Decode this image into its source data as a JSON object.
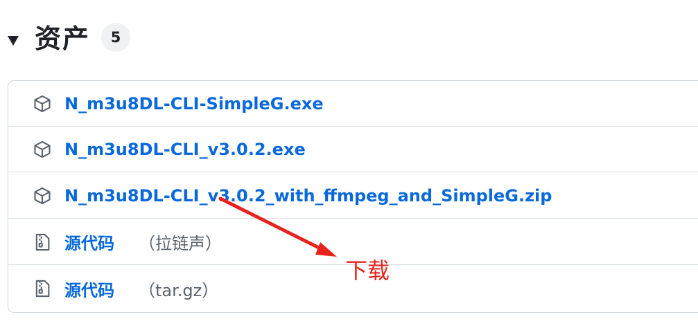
{
  "assets_section": {
    "title": "资产",
    "count": "5",
    "expanded": true,
    "toggle_icon": "triangle-down-icon"
  },
  "assets": [
    {
      "name": "N_m3u8DL-CLI-SimpleG.exe",
      "suffix": "",
      "icon": "package-icon"
    },
    {
      "name": "N_m3u8DL-CLI_v3.0.2.exe",
      "suffix": "",
      "icon": "package-icon"
    },
    {
      "name": "N_m3u8DL-CLI_v3.0.2_with_ffmpeg_and_SimpleG.zip",
      "suffix": "",
      "icon": "package-icon"
    },
    {
      "name": "源代码",
      "suffix": "（拉链声）",
      "icon": "file-zip-icon"
    },
    {
      "name": "源代码",
      "suffix": "（tar.gz）",
      "icon": "file-zip-icon"
    }
  ],
  "annotation": {
    "text": "下载",
    "color": "#e8231d",
    "arrow_icon": "red-arrow"
  },
  "colors": {
    "link": "#0969da",
    "text": "#1f2328",
    "muted": "#59636e",
    "border": "#d0d7de"
  }
}
